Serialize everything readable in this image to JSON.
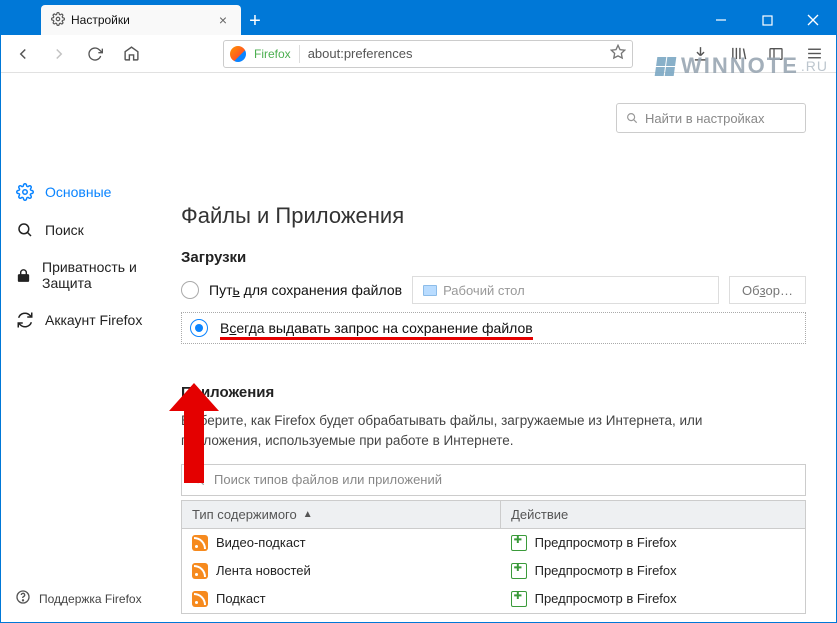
{
  "titlebar": {
    "tab_title": "Настройки"
  },
  "urlbar": {
    "identity": "Firefox",
    "url": "about:preferences"
  },
  "sidebar": {
    "items": [
      {
        "label": "Основные"
      },
      {
        "label": "Поиск"
      },
      {
        "label": "Приватность и Защита"
      },
      {
        "label": "Аккаунт Firefox"
      }
    ],
    "support_label": "Поддержка Firefox"
  },
  "preferences_search": {
    "placeholder": "Найти в настройках"
  },
  "main": {
    "section_title": "Файлы и Приложения",
    "downloads": {
      "heading": "Загрузки",
      "save_path_prefix": "Пут",
      "save_path_u": "ь",
      "save_path_suffix": " для сохранения файлов",
      "folder_label": "Рабочий стол",
      "browse_prefix": "Об",
      "browse_u": "з",
      "browse_suffix": "ор…",
      "always_ask_prefix": "В",
      "always_ask_u": "с",
      "always_ask_suffix": "егда выдавать запрос на сохранение файлов"
    },
    "applications": {
      "heading": "Приложения",
      "description": "Выберите, как Firefox будет обрабатывать файлы, загружаемые из Интернета, или приложения, используемые при работе в Интернете.",
      "search_placeholder": "Поиск типов файлов или приложений",
      "col_type": "Тип содержимого",
      "col_action": "Действие",
      "rows": [
        {
          "type": "Видео-подкаст",
          "action": "Предпросмотр в Firefox"
        },
        {
          "type": "Лента новостей",
          "action": "Предпросмотр в Firefox"
        },
        {
          "type": "Подкаст",
          "action": "Предпросмотр в Firefox"
        }
      ]
    }
  },
  "watermark": {
    "text": "WINNOTE",
    "suffix": ".RU"
  }
}
